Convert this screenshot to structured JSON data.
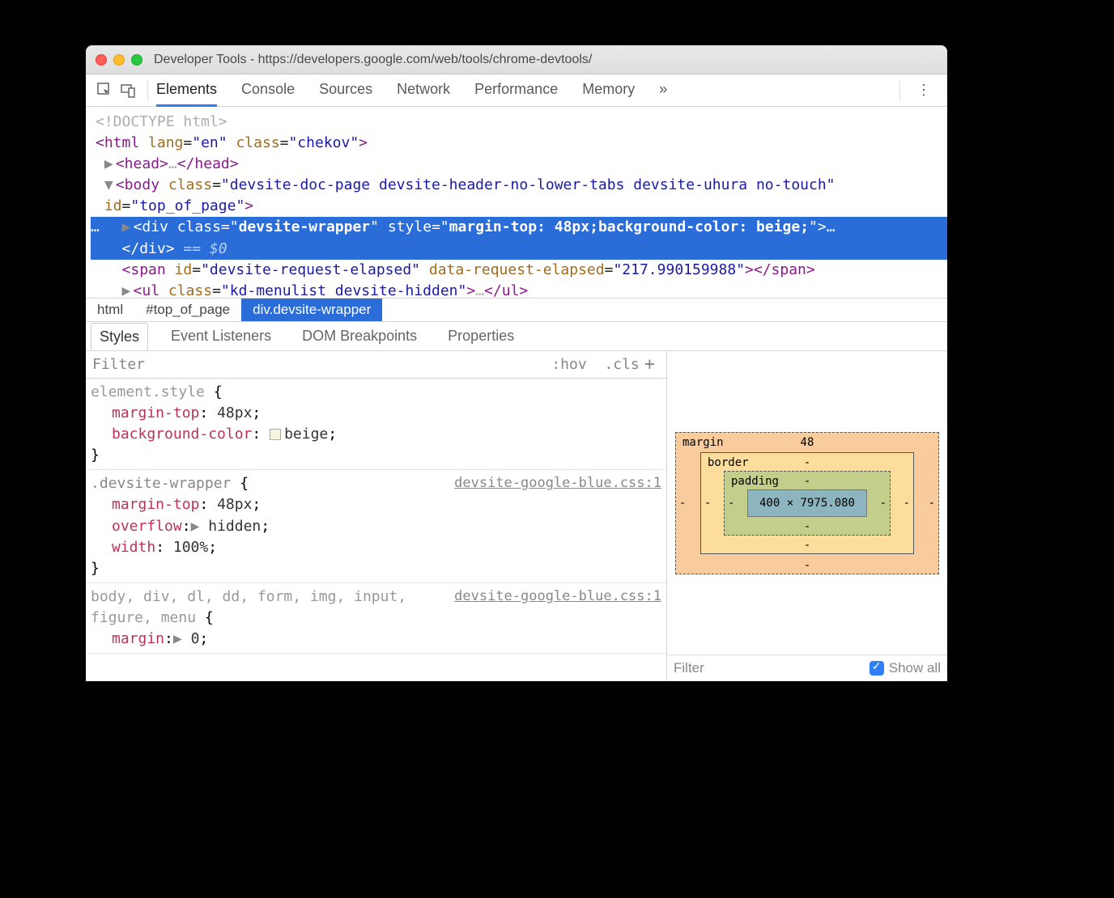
{
  "window": {
    "title": "Developer Tools - https://developers.google.com/web/tools/chrome-devtools/"
  },
  "tabs": [
    "Elements",
    "Console",
    "Sources",
    "Network",
    "Performance",
    "Memory"
  ],
  "tabs_overflow": "»",
  "dom": {
    "doctype": "<!DOCTYPE html>",
    "html_open": "<html lang=\"en\" class=\"chekov\">",
    "selected": {
      "class": "devsite-wrapper",
      "style": "margin-top: 48px;background-color: beige;",
      "eq0": "== $0"
    },
    "span_id": "devsite-request-elapsed",
    "span_attr": "data-request-elapsed",
    "span_val": "217.990159988",
    "ul_class": "kd-menulist devsite-hidden",
    "body_class": "devsite-doc-page devsite-header-no-lower-tabs devsite-uhura no-touch",
    "body_id": "top_of_page"
  },
  "breadcrumbs": [
    "html",
    "#top_of_page",
    "div.devsite-wrapper"
  ],
  "subtabs": [
    "Styles",
    "Event Listeners",
    "DOM Breakpoints",
    "Properties"
  ],
  "styles": {
    "filter_placeholder": "Filter",
    "hov": ":hov",
    "cls": ".cls",
    "rules": [
      {
        "selector": "element.style",
        "src": "",
        "props": [
          {
            "name": "margin-top",
            "value": "48px",
            "strike": false
          },
          {
            "name": "background-color",
            "value": "beige",
            "strike": false,
            "swatch": true
          }
        ]
      },
      {
        "selector": ".devsite-wrapper",
        "src": "devsite-google-blue.css:1",
        "props": [
          {
            "name": "margin-top",
            "value": "48px",
            "strike": true
          },
          {
            "name": "overflow",
            "value": "hidden",
            "strike": false,
            "expand": true
          },
          {
            "name": "width",
            "value": "100%",
            "strike": false
          }
        ]
      },
      {
        "selector": "body, div, dl, dd, form, img, input, figure, menu",
        "src": "devsite-google-blue.css:1",
        "props": [
          {
            "name": "margin",
            "value": "0",
            "strike": false,
            "expand": true
          }
        ]
      }
    ]
  },
  "boxmodel": {
    "margin": {
      "label": "margin",
      "top": "48",
      "right": "-",
      "bottom": "-",
      "left": "-"
    },
    "border": {
      "label": "border",
      "top": "-",
      "right": "-",
      "bottom": "-",
      "left": "-"
    },
    "padding": {
      "label": "padding",
      "top": "-",
      "right": "-",
      "bottom": "-",
      "left": "-"
    },
    "content": "400 × 7975.080"
  },
  "computed": {
    "filter_placeholder": "Filter",
    "showall": "Show all"
  }
}
